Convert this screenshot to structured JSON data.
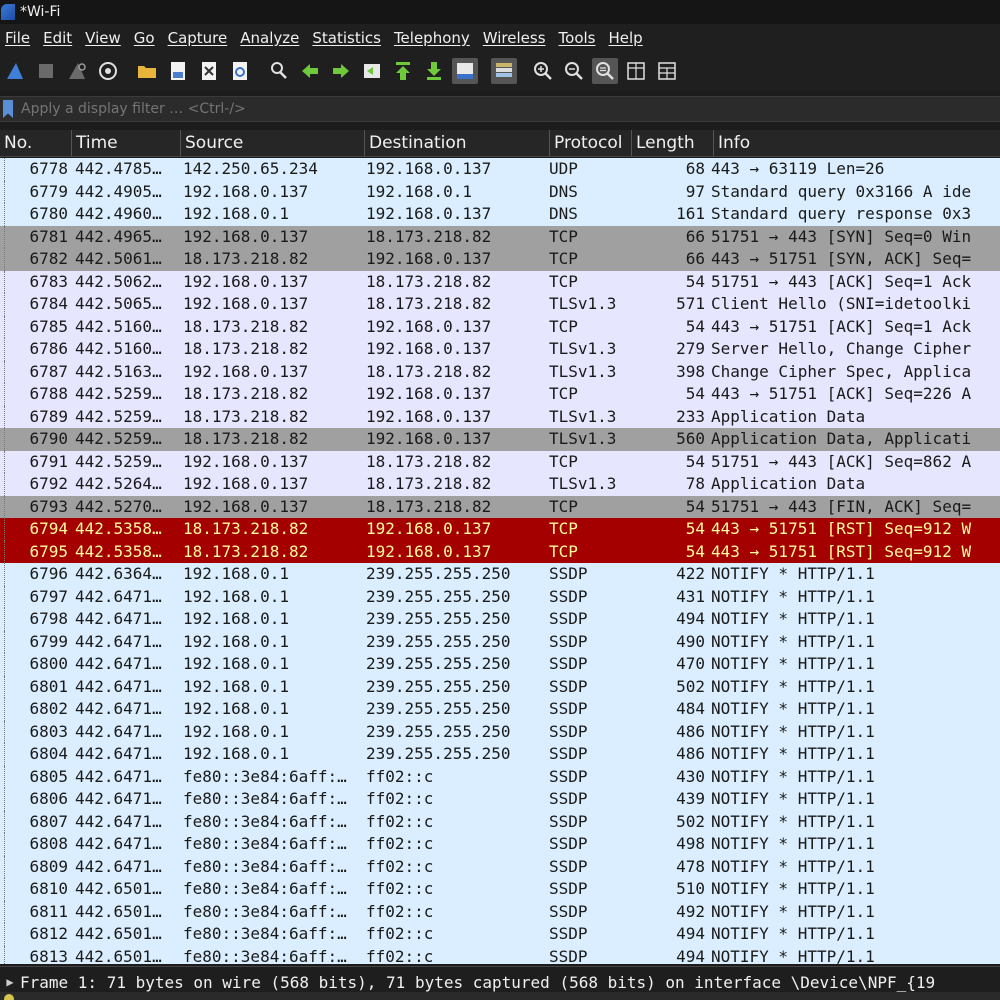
{
  "window": {
    "title": "*Wi-Fi"
  },
  "menu": [
    "File",
    "Edit",
    "View",
    "Go",
    "Capture",
    "Analyze",
    "Statistics",
    "Telephony",
    "Wireless",
    "Tools",
    "Help"
  ],
  "toolbar": {
    "icons": [
      "shark-fin-start-icon",
      "stop-square-icon",
      "shark-fin-restart-icon",
      "capture-options-gear-icon",
      "open-folder-icon",
      "save-file-icon",
      "close-file-icon",
      "reload-icon",
      "find-magnifier-icon",
      "back-arrow-icon",
      "forward-arrow-icon",
      "go-to-packet-icon",
      "first-packet-icon",
      "last-packet-icon",
      "autoscroll-icon",
      "colorize-icon",
      "zoom-in-icon",
      "zoom-out-icon",
      "normal-size-icon",
      "resize-columns-icon",
      "layout-icon"
    ]
  },
  "filter": {
    "placeholder": "Apply a display filter … <Ctrl-/>"
  },
  "columns": [
    "No.",
    "Time",
    "Source",
    "Destination",
    "Protocol",
    "Length",
    "Info"
  ],
  "colors": {
    "udp": "#daeeff",
    "tcp": "#e7e6ff",
    "syn": "#a0a0a0",
    "rst": "#a40000"
  },
  "packets": [
    {
      "no": "6778",
      "time": "442.4785…",
      "src": "142.250.65.234",
      "dst": "192.168.0.137",
      "proto": "UDP",
      "len": "68",
      "info": "443 → 63119 Len=26",
      "bg": "udp"
    },
    {
      "no": "6779",
      "time": "442.4905…",
      "src": "192.168.0.137",
      "dst": "192.168.0.1",
      "proto": "DNS",
      "len": "97",
      "info": "Standard query 0x3166 A ide",
      "bg": "udp"
    },
    {
      "no": "6780",
      "time": "442.4960…",
      "src": "192.168.0.1",
      "dst": "192.168.0.137",
      "proto": "DNS",
      "len": "161",
      "info": "Standard query response 0x3",
      "bg": "udp"
    },
    {
      "no": "6781",
      "time": "442.4965…",
      "src": "192.168.0.137",
      "dst": "18.173.218.82",
      "proto": "TCP",
      "len": "66",
      "info": "51751 → 443 [SYN] Seq=0 Win",
      "bg": "syn"
    },
    {
      "no": "6782",
      "time": "442.5061…",
      "src": "18.173.218.82",
      "dst": "192.168.0.137",
      "proto": "TCP",
      "len": "66",
      "info": "443 → 51751 [SYN, ACK] Seq=",
      "bg": "syn"
    },
    {
      "no": "6783",
      "time": "442.5062…",
      "src": "192.168.0.137",
      "dst": "18.173.218.82",
      "proto": "TCP",
      "len": "54",
      "info": "51751 → 443 [ACK] Seq=1 Ack",
      "bg": "tcp"
    },
    {
      "no": "6784",
      "time": "442.5065…",
      "src": "192.168.0.137",
      "dst": "18.173.218.82",
      "proto": "TLSv1.3",
      "len": "571",
      "info": "Client Hello (SNI=idetoolki",
      "bg": "tcp"
    },
    {
      "no": "6785",
      "time": "442.5160…",
      "src": "18.173.218.82",
      "dst": "192.168.0.137",
      "proto": "TCP",
      "len": "54",
      "info": "443 → 51751 [ACK] Seq=1 Ack",
      "bg": "tcp"
    },
    {
      "no": "6786",
      "time": "442.5160…",
      "src": "18.173.218.82",
      "dst": "192.168.0.137",
      "proto": "TLSv1.3",
      "len": "279",
      "info": "Server Hello, Change Cipher",
      "bg": "tcp"
    },
    {
      "no": "6787",
      "time": "442.5163…",
      "src": "192.168.0.137",
      "dst": "18.173.218.82",
      "proto": "TLSv1.3",
      "len": "398",
      "info": "Change Cipher Spec, Applica",
      "bg": "tcp"
    },
    {
      "no": "6788",
      "time": "442.5259…",
      "src": "18.173.218.82",
      "dst": "192.168.0.137",
      "proto": "TCP",
      "len": "54",
      "info": "443 → 51751 [ACK] Seq=226 A",
      "bg": "tcp"
    },
    {
      "no": "6789",
      "time": "442.5259…",
      "src": "18.173.218.82",
      "dst": "192.168.0.137",
      "proto": "TLSv1.3",
      "len": "233",
      "info": "Application Data",
      "bg": "tcp"
    },
    {
      "no": "6790",
      "time": "442.5259…",
      "src": "18.173.218.82",
      "dst": "192.168.0.137",
      "proto": "TLSv1.3",
      "len": "560",
      "info": "Application Data, Applicati",
      "bg": "syn"
    },
    {
      "no": "6791",
      "time": "442.5259…",
      "src": "192.168.0.137",
      "dst": "18.173.218.82",
      "proto": "TCP",
      "len": "54",
      "info": "51751 → 443 [ACK] Seq=862 A",
      "bg": "tcp"
    },
    {
      "no": "6792",
      "time": "442.5264…",
      "src": "192.168.0.137",
      "dst": "18.173.218.82",
      "proto": "TLSv1.3",
      "len": "78",
      "info": "Application Data",
      "bg": "tcp"
    },
    {
      "no": "6793",
      "time": "442.5270…",
      "src": "192.168.0.137",
      "dst": "18.173.218.82",
      "proto": "TCP",
      "len": "54",
      "info": "51751 → 443 [FIN, ACK] Seq=",
      "bg": "syn"
    },
    {
      "no": "6794",
      "time": "442.5358…",
      "src": "18.173.218.82",
      "dst": "192.168.0.137",
      "proto": "TCP",
      "len": "54",
      "info": "443 → 51751 [RST] Seq=912 W",
      "bg": "rst"
    },
    {
      "no": "6795",
      "time": "442.5358…",
      "src": "18.173.218.82",
      "dst": "192.168.0.137",
      "proto": "TCP",
      "len": "54",
      "info": "443 → 51751 [RST] Seq=912 W",
      "bg": "rst"
    },
    {
      "no": "6796",
      "time": "442.6364…",
      "src": "192.168.0.1",
      "dst": "239.255.255.250",
      "proto": "SSDP",
      "len": "422",
      "info": "NOTIFY * HTTP/1.1",
      "bg": "udp"
    },
    {
      "no": "6797",
      "time": "442.6471…",
      "src": "192.168.0.1",
      "dst": "239.255.255.250",
      "proto": "SSDP",
      "len": "431",
      "info": "NOTIFY * HTTP/1.1",
      "bg": "udp"
    },
    {
      "no": "6798",
      "time": "442.6471…",
      "src": "192.168.0.1",
      "dst": "239.255.255.250",
      "proto": "SSDP",
      "len": "494",
      "info": "NOTIFY * HTTP/1.1",
      "bg": "udp"
    },
    {
      "no": "6799",
      "time": "442.6471…",
      "src": "192.168.0.1",
      "dst": "239.255.255.250",
      "proto": "SSDP",
      "len": "490",
      "info": "NOTIFY * HTTP/1.1",
      "bg": "udp"
    },
    {
      "no": "6800",
      "time": "442.6471…",
      "src": "192.168.0.1",
      "dst": "239.255.255.250",
      "proto": "SSDP",
      "len": "470",
      "info": "NOTIFY * HTTP/1.1",
      "bg": "udp"
    },
    {
      "no": "6801",
      "time": "442.6471…",
      "src": "192.168.0.1",
      "dst": "239.255.255.250",
      "proto": "SSDP",
      "len": "502",
      "info": "NOTIFY * HTTP/1.1",
      "bg": "udp"
    },
    {
      "no": "6802",
      "time": "442.6471…",
      "src": "192.168.0.1",
      "dst": "239.255.255.250",
      "proto": "SSDP",
      "len": "484",
      "info": "NOTIFY * HTTP/1.1",
      "bg": "udp"
    },
    {
      "no": "6803",
      "time": "442.6471…",
      "src": "192.168.0.1",
      "dst": "239.255.255.250",
      "proto": "SSDP",
      "len": "486",
      "info": "NOTIFY * HTTP/1.1",
      "bg": "udp"
    },
    {
      "no": "6804",
      "time": "442.6471…",
      "src": "192.168.0.1",
      "dst": "239.255.255.250",
      "proto": "SSDP",
      "len": "486",
      "info": "NOTIFY * HTTP/1.1",
      "bg": "udp"
    },
    {
      "no": "6805",
      "time": "442.6471…",
      "src": "fe80::3e84:6aff:…",
      "dst": "ff02::c",
      "proto": "SSDP",
      "len": "430",
      "info": "NOTIFY * HTTP/1.1",
      "bg": "udp"
    },
    {
      "no": "6806",
      "time": "442.6471…",
      "src": "fe80::3e84:6aff:…",
      "dst": "ff02::c",
      "proto": "SSDP",
      "len": "439",
      "info": "NOTIFY * HTTP/1.1",
      "bg": "udp"
    },
    {
      "no": "6807",
      "time": "442.6471…",
      "src": "fe80::3e84:6aff:…",
      "dst": "ff02::c",
      "proto": "SSDP",
      "len": "502",
      "info": "NOTIFY * HTTP/1.1",
      "bg": "udp"
    },
    {
      "no": "6808",
      "time": "442.6471…",
      "src": "fe80::3e84:6aff:…",
      "dst": "ff02::c",
      "proto": "SSDP",
      "len": "498",
      "info": "NOTIFY * HTTP/1.1",
      "bg": "udp"
    },
    {
      "no": "6809",
      "time": "442.6471…",
      "src": "fe80::3e84:6aff:…",
      "dst": "ff02::c",
      "proto": "SSDP",
      "len": "478",
      "info": "NOTIFY * HTTP/1.1",
      "bg": "udp"
    },
    {
      "no": "6810",
      "time": "442.6501…",
      "src": "fe80::3e84:6aff:…",
      "dst": "ff02::c",
      "proto": "SSDP",
      "len": "510",
      "info": "NOTIFY * HTTP/1.1",
      "bg": "udp"
    },
    {
      "no": "6811",
      "time": "442.6501…",
      "src": "fe80::3e84:6aff:…",
      "dst": "ff02::c",
      "proto": "SSDP",
      "len": "492",
      "info": "NOTIFY * HTTP/1.1",
      "bg": "udp"
    },
    {
      "no": "6812",
      "time": "442.6501…",
      "src": "fe80::3e84:6aff:…",
      "dst": "ff02::c",
      "proto": "SSDP",
      "len": "494",
      "info": "NOTIFY * HTTP/1.1",
      "bg": "udp"
    },
    {
      "no": "6813",
      "time": "442.6501…",
      "src": "fe80::3e84:6aff:…",
      "dst": "ff02::c",
      "proto": "SSDP",
      "len": "494",
      "info": "NOTIFY * HTTP/1.1",
      "bg": "udp"
    }
  ],
  "details": {
    "frame_line": "Frame 1: 71 bytes on wire (568 bits), 71 bytes captured (568 bits) on interface \\Device\\NPF_{19"
  }
}
